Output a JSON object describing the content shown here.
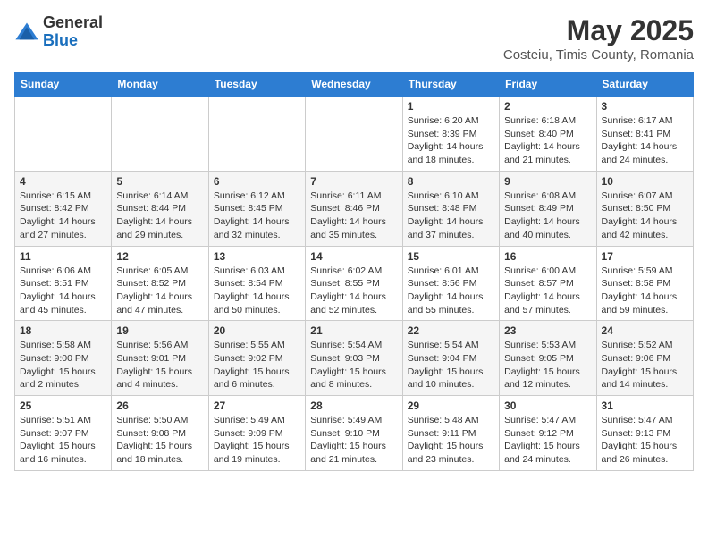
{
  "header": {
    "logo_line1": "General",
    "logo_line2": "Blue",
    "title": "May 2025",
    "subtitle": "Costeiu, Timis County, Romania"
  },
  "weekdays": [
    "Sunday",
    "Monday",
    "Tuesday",
    "Wednesday",
    "Thursday",
    "Friday",
    "Saturday"
  ],
  "weeks": [
    [
      {
        "day": "",
        "info": ""
      },
      {
        "day": "",
        "info": ""
      },
      {
        "day": "",
        "info": ""
      },
      {
        "day": "",
        "info": ""
      },
      {
        "day": "1",
        "info": "Sunrise: 6:20 AM\nSunset: 8:39 PM\nDaylight: 14 hours\nand 18 minutes."
      },
      {
        "day": "2",
        "info": "Sunrise: 6:18 AM\nSunset: 8:40 PM\nDaylight: 14 hours\nand 21 minutes."
      },
      {
        "day": "3",
        "info": "Sunrise: 6:17 AM\nSunset: 8:41 PM\nDaylight: 14 hours\nand 24 minutes."
      }
    ],
    [
      {
        "day": "4",
        "info": "Sunrise: 6:15 AM\nSunset: 8:42 PM\nDaylight: 14 hours\nand 27 minutes."
      },
      {
        "day": "5",
        "info": "Sunrise: 6:14 AM\nSunset: 8:44 PM\nDaylight: 14 hours\nand 29 minutes."
      },
      {
        "day": "6",
        "info": "Sunrise: 6:12 AM\nSunset: 8:45 PM\nDaylight: 14 hours\nand 32 minutes."
      },
      {
        "day": "7",
        "info": "Sunrise: 6:11 AM\nSunset: 8:46 PM\nDaylight: 14 hours\nand 35 minutes."
      },
      {
        "day": "8",
        "info": "Sunrise: 6:10 AM\nSunset: 8:48 PM\nDaylight: 14 hours\nand 37 minutes."
      },
      {
        "day": "9",
        "info": "Sunrise: 6:08 AM\nSunset: 8:49 PM\nDaylight: 14 hours\nand 40 minutes."
      },
      {
        "day": "10",
        "info": "Sunrise: 6:07 AM\nSunset: 8:50 PM\nDaylight: 14 hours\nand 42 minutes."
      }
    ],
    [
      {
        "day": "11",
        "info": "Sunrise: 6:06 AM\nSunset: 8:51 PM\nDaylight: 14 hours\nand 45 minutes."
      },
      {
        "day": "12",
        "info": "Sunrise: 6:05 AM\nSunset: 8:52 PM\nDaylight: 14 hours\nand 47 minutes."
      },
      {
        "day": "13",
        "info": "Sunrise: 6:03 AM\nSunset: 8:54 PM\nDaylight: 14 hours\nand 50 minutes."
      },
      {
        "day": "14",
        "info": "Sunrise: 6:02 AM\nSunset: 8:55 PM\nDaylight: 14 hours\nand 52 minutes."
      },
      {
        "day": "15",
        "info": "Sunrise: 6:01 AM\nSunset: 8:56 PM\nDaylight: 14 hours\nand 55 minutes."
      },
      {
        "day": "16",
        "info": "Sunrise: 6:00 AM\nSunset: 8:57 PM\nDaylight: 14 hours\nand 57 minutes."
      },
      {
        "day": "17",
        "info": "Sunrise: 5:59 AM\nSunset: 8:58 PM\nDaylight: 14 hours\nand 59 minutes."
      }
    ],
    [
      {
        "day": "18",
        "info": "Sunrise: 5:58 AM\nSunset: 9:00 PM\nDaylight: 15 hours\nand 2 minutes."
      },
      {
        "day": "19",
        "info": "Sunrise: 5:56 AM\nSunset: 9:01 PM\nDaylight: 15 hours\nand 4 minutes."
      },
      {
        "day": "20",
        "info": "Sunrise: 5:55 AM\nSunset: 9:02 PM\nDaylight: 15 hours\nand 6 minutes."
      },
      {
        "day": "21",
        "info": "Sunrise: 5:54 AM\nSunset: 9:03 PM\nDaylight: 15 hours\nand 8 minutes."
      },
      {
        "day": "22",
        "info": "Sunrise: 5:54 AM\nSunset: 9:04 PM\nDaylight: 15 hours\nand 10 minutes."
      },
      {
        "day": "23",
        "info": "Sunrise: 5:53 AM\nSunset: 9:05 PM\nDaylight: 15 hours\nand 12 minutes."
      },
      {
        "day": "24",
        "info": "Sunrise: 5:52 AM\nSunset: 9:06 PM\nDaylight: 15 hours\nand 14 minutes."
      }
    ],
    [
      {
        "day": "25",
        "info": "Sunrise: 5:51 AM\nSunset: 9:07 PM\nDaylight: 15 hours\nand 16 minutes."
      },
      {
        "day": "26",
        "info": "Sunrise: 5:50 AM\nSunset: 9:08 PM\nDaylight: 15 hours\nand 18 minutes."
      },
      {
        "day": "27",
        "info": "Sunrise: 5:49 AM\nSunset: 9:09 PM\nDaylight: 15 hours\nand 19 minutes."
      },
      {
        "day": "28",
        "info": "Sunrise: 5:49 AM\nSunset: 9:10 PM\nDaylight: 15 hours\nand 21 minutes."
      },
      {
        "day": "29",
        "info": "Sunrise: 5:48 AM\nSunset: 9:11 PM\nDaylight: 15 hours\nand 23 minutes."
      },
      {
        "day": "30",
        "info": "Sunrise: 5:47 AM\nSunset: 9:12 PM\nDaylight: 15 hours\nand 24 minutes."
      },
      {
        "day": "31",
        "info": "Sunrise: 5:47 AM\nSunset: 9:13 PM\nDaylight: 15 hours\nand 26 minutes."
      }
    ]
  ]
}
